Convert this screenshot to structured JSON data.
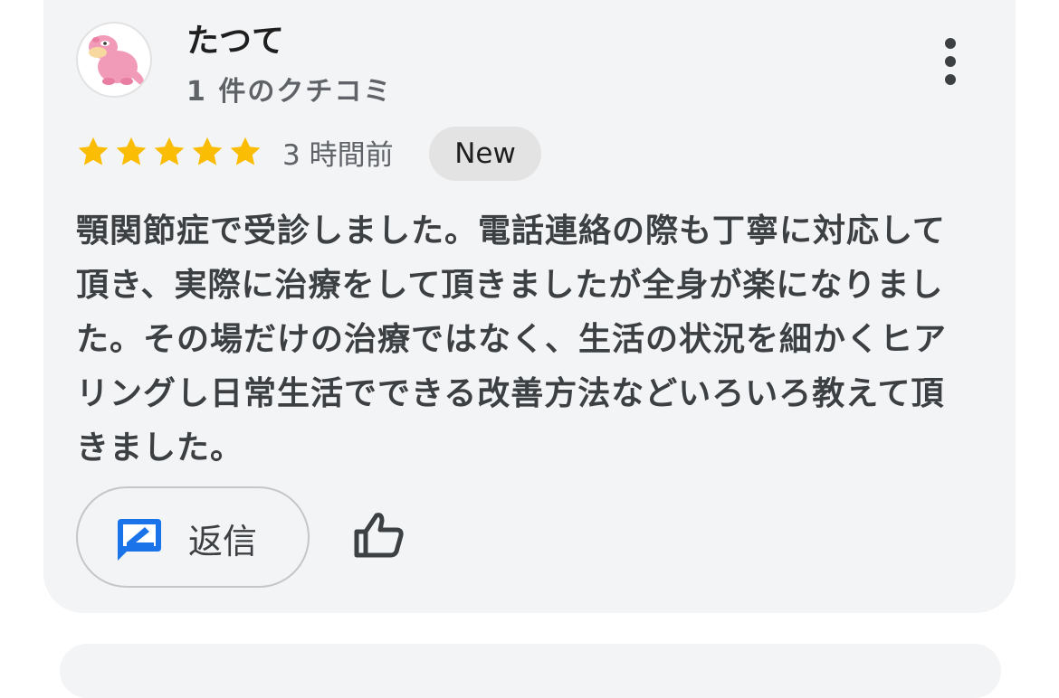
{
  "review": {
    "author": "たつて",
    "review_count": "1 件のクチコミ",
    "rating": 5,
    "rating_max": 5,
    "time": "3 時間前",
    "badge": "New",
    "text": "顎関節症で受診しました。電話連絡の際も丁寧に対応して頂き、実際に治療をして頂きましたが全身が楽になりました。その場だけの治療ではなく、生活の状況を細かくヒアリングし日常生活でできる改善方法などいろいろ教えて頂きました。",
    "more_icon": "more-vertical-icon",
    "avatar_icon": "slowpoke-avatar"
  },
  "actions": {
    "reply_label": "返信",
    "reply_icon": "reply-edit-icon",
    "like_icon": "thumbs-up-icon"
  },
  "colors": {
    "card_background": "#f3f4f6",
    "star": "#fbbc04",
    "reply_icon": "#1a73e8",
    "badge_background": "#e3e3e3"
  }
}
